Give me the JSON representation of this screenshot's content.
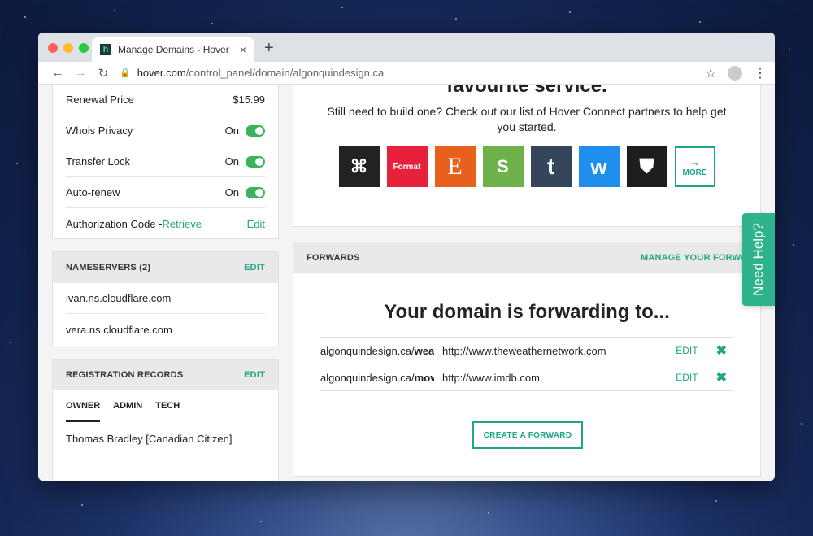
{
  "browser": {
    "tab_title": "Manage Domains - Hover",
    "favicon_letter": "h",
    "new_tab": "+",
    "close_tab": "×",
    "url_host": "hover.com",
    "url_path": "/control_panel/domain/algonquindesign.ca"
  },
  "domain_settings": {
    "renewal_price_label": "Renewal Price",
    "renewal_price_value": "$15.99",
    "whois_label": "Whois Privacy",
    "whois_value": "On",
    "transfer_lock_label": "Transfer Lock",
    "transfer_lock_value": "On",
    "autorenew_label": "Auto-renew",
    "autorenew_value": "On",
    "auth_code_label": "Authorization Code -",
    "auth_code_link": "Retrieve",
    "auth_code_edit": "Edit"
  },
  "nameservers": {
    "title": "NAMESERVERS (2)",
    "edit": "EDIT",
    "items": [
      "ivan.ns.cloudflare.com",
      "vera.ns.cloudflare.com"
    ]
  },
  "registration": {
    "title": "REGISTRATION RECORDS",
    "edit": "EDIT",
    "tabs": [
      "OWNER",
      "ADMIN",
      "TECH"
    ],
    "owner_name": "Thomas Bradley [Canadian Citizen]"
  },
  "connect": {
    "heading_partial": "favourite service.",
    "subtext": "Still need to build one? Check out our list of Hover Connect partners to help get you started.",
    "partners": [
      {
        "name": "Squarespace",
        "glyph": "⌘",
        "color": "#222222"
      },
      {
        "name": "Format",
        "glyph": "Format",
        "color": "#e8213a"
      },
      {
        "name": "Etsy",
        "glyph": "E",
        "color": "#e8611c"
      },
      {
        "name": "Shopify",
        "glyph": "S",
        "color": "#6eb04a"
      },
      {
        "name": "Tumblr",
        "glyph": "t",
        "color": "#35465c"
      },
      {
        "name": "Weebly",
        "glyph": "w",
        "color": "#1f8eed"
      },
      {
        "name": "Kajabi",
        "glyph": "⛊",
        "color": "#1e1e1e"
      }
    ],
    "more_arrow": "→",
    "more_label": "MORE"
  },
  "forwards": {
    "title": "FORWARDS",
    "manage": "MANAGE YOUR FORWARD",
    "heading": "Your domain is forwarding to...",
    "rows": [
      {
        "src_domain": "algonquindesign.ca/",
        "src_path": "weat",
        "dst": "http://www.theweathernetwork.com",
        "edit": "EDIT",
        "delete": "✖"
      },
      {
        "src_domain": "algonquindesign.ca/",
        "src_path": "movi",
        "dst": "http://www.imdb.com",
        "edit": "EDIT",
        "delete": "✖"
      }
    ],
    "create_button": "CREATE A FORWARD"
  },
  "help_tab": "Need Help?"
}
